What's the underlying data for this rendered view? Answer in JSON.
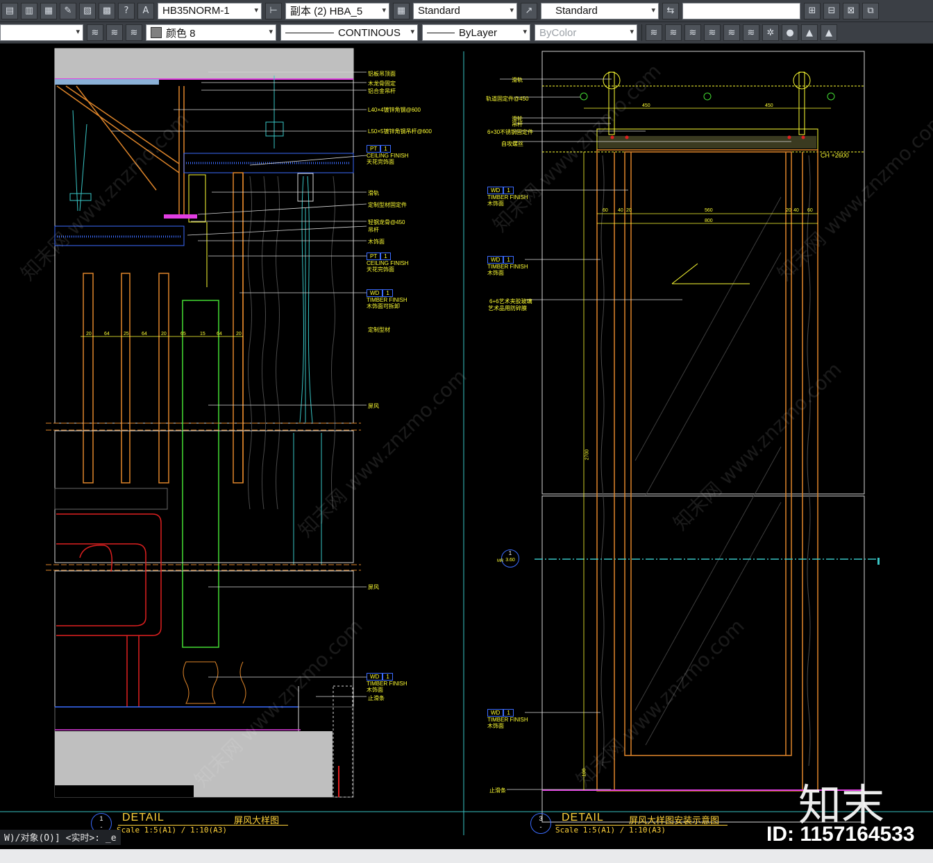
{
  "toolbar1": {
    "text_style": "HB35NORM-1",
    "dim_style": "副本 (2) HBA_5",
    "table_style": "Standard",
    "multileader_style": "Standard",
    "search_value": ""
  },
  "toolbar2": {
    "layer": "",
    "color": "颜色 8",
    "linetype": "CONTINOUS",
    "lineweight": "ByLayer",
    "plotstyle": "ByColor"
  },
  "icons": [
    "save-icon",
    "layers-icon",
    "grid-icon",
    "pencil-icon",
    "paste-icon",
    "calculator-icon",
    "help-icon",
    "text-style-icon",
    "dim-style-icon",
    "table-style-icon",
    "mleader-style-icon",
    "layer-states-icon",
    "layer-isolate-icon",
    "layer-freeze-icon",
    "layer-lock-icon",
    "layer-walk-icon",
    "make-current-icon",
    "match-layer-icon"
  ],
  "drawing": {
    "left_labels": [
      "铝板吊顶面",
      "木龙骨固定",
      "铝合金吊杆",
      "L40×4镀锌角钢@600",
      "L50×5镀锌角钢吊杆@600",
      "滑轨",
      "定制型材固定件",
      "轻钢龙骨@450",
      "吊杆",
      "木饰面",
      "定制型材",
      "屏风",
      "屏风",
      "止滑条"
    ],
    "left_tags": [
      {
        "code": "PT",
        "num": "1",
        "t1": "CEILING FINISH",
        "t2": "天花完饰面"
      },
      {
        "code": "PT",
        "num": "1",
        "t1": "CEILING FINISH",
        "t2": "天花完饰面"
      },
      {
        "code": "WD",
        "num": "1",
        "t1": "TIMBER FINISH",
        "t2": "木饰面可拆卸"
      },
      {
        "code": "WD",
        "num": "1",
        "t1": "TIMBER FINISH",
        "t2": "木饰面"
      }
    ],
    "left_dims": [
      "20",
      "64",
      "25",
      "64",
      "20",
      "65",
      "15",
      "64",
      "20"
    ],
    "right_labels": [
      "滑轨",
      "轨道固定件@450",
      "滑轮",
      "吊杆",
      "6×30不锈钢固定件",
      "自攻螺丝",
      "6+6艺术夹胶玻璃",
      "艺术品用防碎膜",
      "止滑条"
    ],
    "right_tags": [
      {
        "code": "WD",
        "num": "1",
        "t1": "TIMBER FINISH",
        "t2": "木饰面"
      },
      {
        "code": "WD",
        "num": "1",
        "t1": "TIMBER FINISH",
        "t2": "木饰面"
      },
      {
        "code": "WD",
        "num": "1",
        "t1": "TIMBER FINISH",
        "t2": "木饰面"
      }
    ],
    "right_dims": [
      "450",
      "450",
      "60",
      "40",
      "20",
      "560",
      "20",
      "40",
      "60",
      "800",
      "2700",
      "100"
    ],
    "ch_mark": "CH +2600",
    "section_mark": {
      "num": "1",
      "ref": "3.60",
      "label": "MR"
    },
    "details": [
      {
        "num": "1",
        "sub": "-",
        "word": "DETAIL",
        "title": "屏风大样图",
        "scale": "Scale 1:5(A1) / 1:10(A3)"
      },
      {
        "num": "3",
        "sub": "-",
        "word": "DETAIL",
        "title": "屏风大样图安装示意图",
        "scale": "Scale 1:5(A1) / 1:10(A3)"
      }
    ],
    "watermark": "知末网 www.znzmo.com"
  },
  "command_line": "W)/对象(O)] <实时>: _e",
  "brand": "知末",
  "image_id": "ID: 1157164533",
  "colors": {
    "accent": "#ffff33",
    "orange": "#e0862a",
    "cyan": "#39c6c6",
    "blue": "#3b6cff",
    "magenta": "#e23ee2",
    "green": "#44dd33"
  }
}
